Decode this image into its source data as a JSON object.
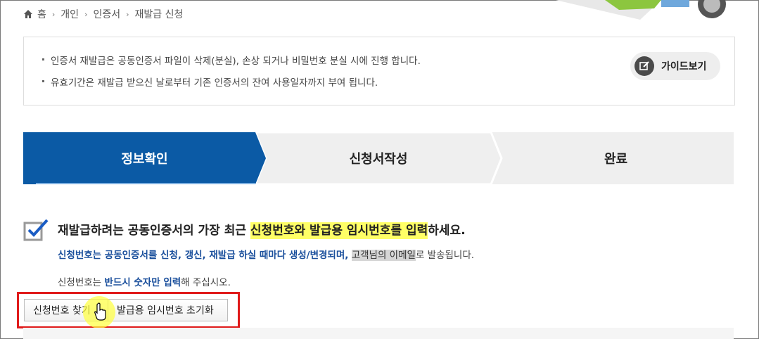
{
  "breadcrumb": [
    "홈",
    "개인",
    "인증서",
    "재발급 신청"
  ],
  "notice": {
    "items": [
      "인증서 재발급은 공동인증서 파일이 삭제(분실), 손상 되거나 비밀번호 분실 시에 진행 합니다.",
      "유효기간은 재발급 받으신 날로부터 기존 인증서의 잔여 사용일자까지 부여 됩니다."
    ],
    "guide_label": "가이드보기"
  },
  "steps": [
    {
      "label": "정보확인",
      "active": true
    },
    {
      "label": "신청서작성",
      "active": false
    },
    {
      "label": "완료",
      "active": false
    }
  ],
  "instruction": {
    "title_pre": "재발급하려는 공동인증서의 가장 최근 ",
    "title_hl": "신청번호와 발급용 임시번호를 입력",
    "title_post": "하세요.",
    "line1_blue": "신청번호는 공동인증서를 신청, 갱신, 재발급 하실 때마다 생성/변경되며,",
    "line1_hl": "고객님의 이메일",
    "line1_post": "로 발송됩니다.",
    "line2_pre": "신청번호는 ",
    "line2_blue": "반드시 숫자만 입력",
    "line2_post": "해 주십시오."
  },
  "buttons": {
    "find_number": "신청번호 찾기",
    "reset_temp": "발급용 임시번호 초기화"
  },
  "colors": {
    "active_step": "#0b5aa5",
    "inactive_step": "#efefef",
    "highlight": "#ffff66",
    "annotation": "#e01b1b"
  }
}
